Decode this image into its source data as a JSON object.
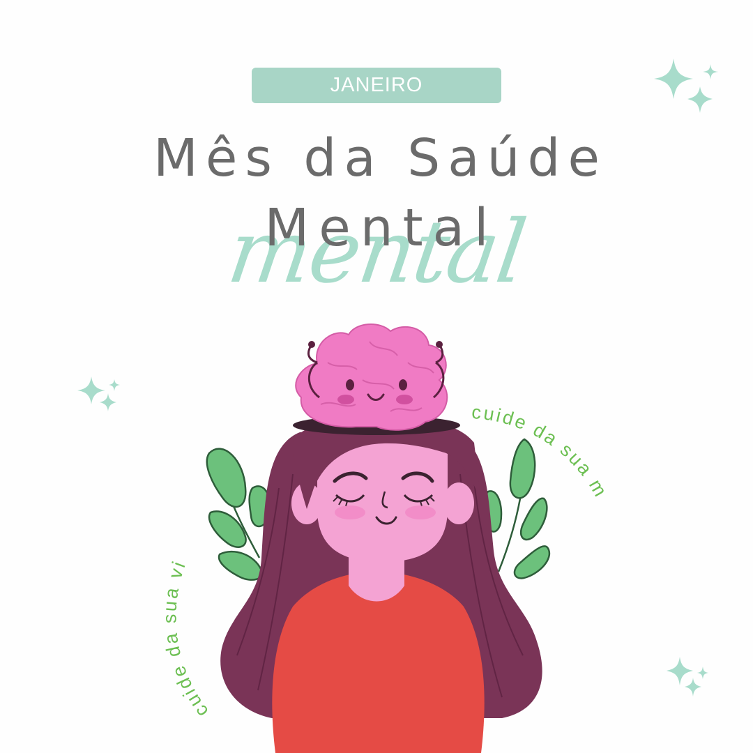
{
  "badge": {
    "label": "JANEIRO"
  },
  "title": {
    "line1": "Mês da Saúde",
    "line2": "Mental",
    "script_word": "mental"
  },
  "curved_texts": {
    "right": "cuide da sua mente",
    "left": "cuide da sua vida"
  },
  "colors": {
    "badge": "#a8d5c6",
    "title": "#6b6b6b",
    "script": "#a8dccb",
    "curved_text": "#6cbf52",
    "sparkle": "#a8dccb",
    "hair": "#7a3457",
    "skin": "#f4a3d3",
    "shirt": "#e54b45",
    "brain": "#f07bc4",
    "leaf": "#6cc17c"
  },
  "icons": [
    "sparkle-icon",
    "leaf-icon",
    "brain-icon"
  ]
}
